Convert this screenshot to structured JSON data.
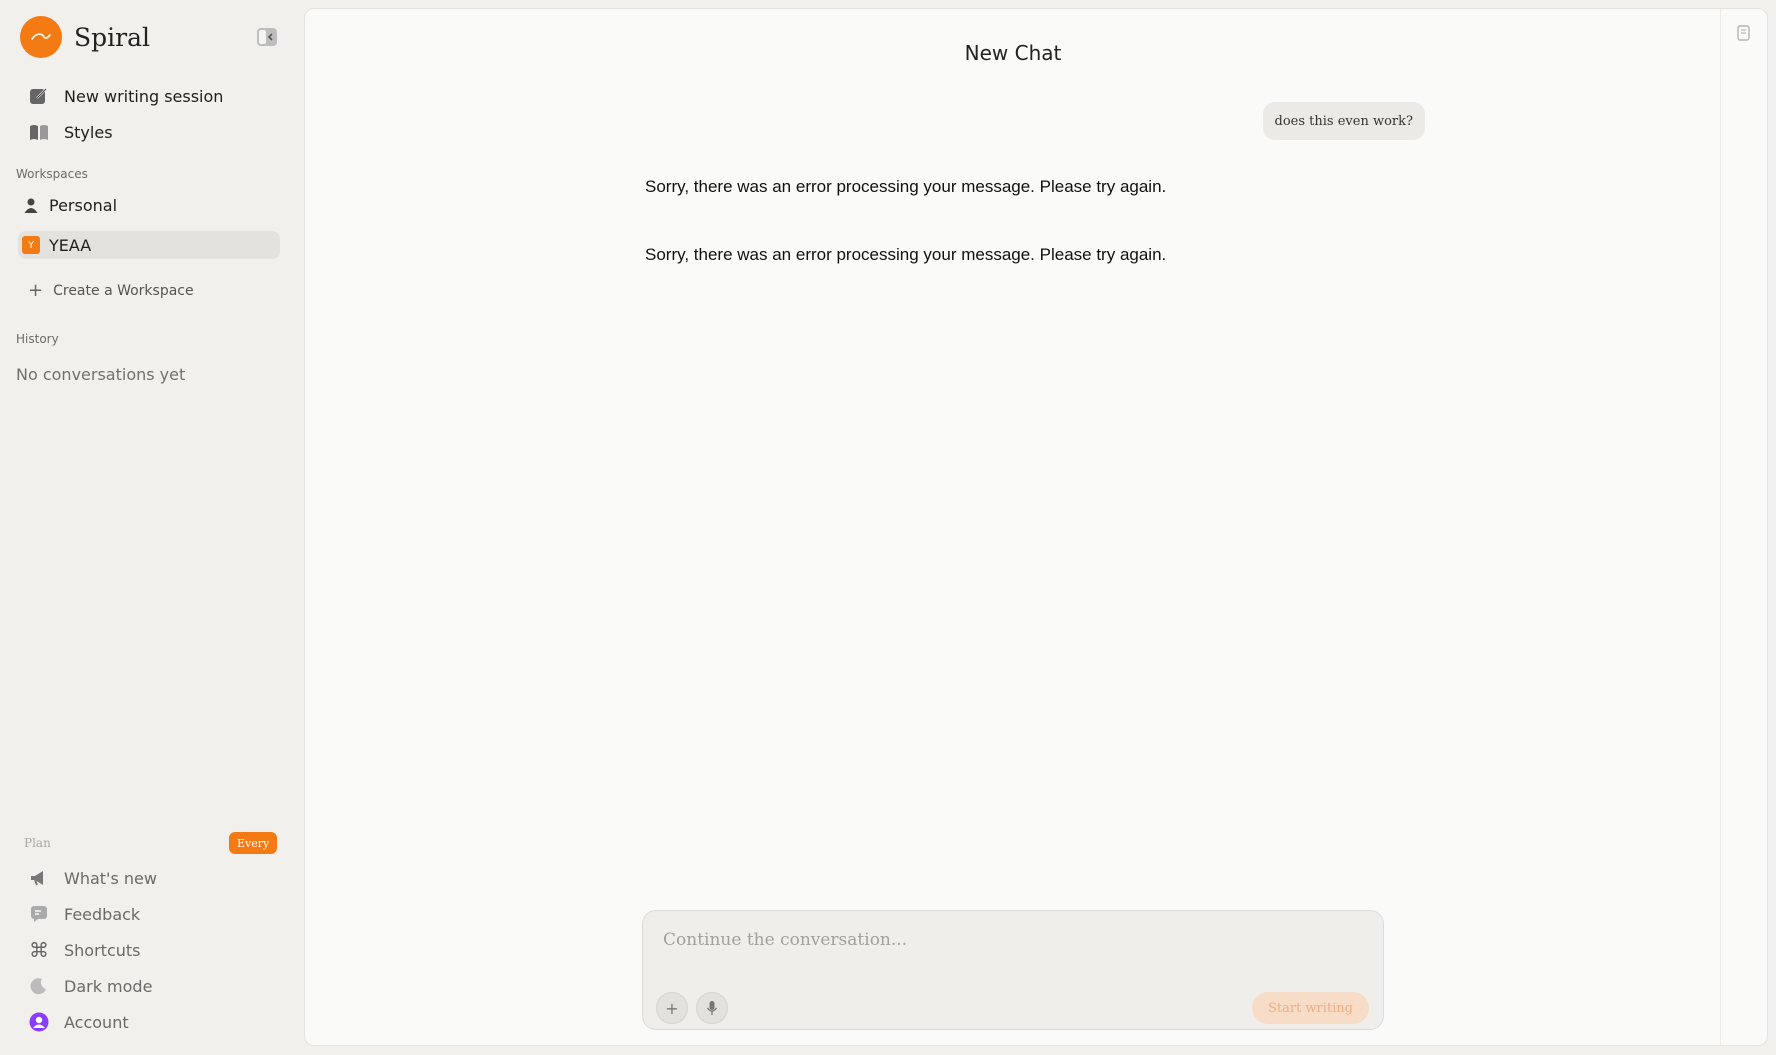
{
  "brand": {
    "name": "Spiral",
    "accent": "#f47a14"
  },
  "nav": [
    {
      "label": "New writing session",
      "icon": "new-writing-icon"
    },
    {
      "label": "Styles",
      "icon": "book-icon"
    }
  ],
  "workspaces": {
    "label": "Workspaces",
    "items": [
      {
        "label": "Personal",
        "icon": "person-icon",
        "active": false
      },
      {
        "label": "YEAA",
        "badge": "Y",
        "active": true
      }
    ],
    "create_label": "Create a Workspace"
  },
  "history": {
    "label": "History",
    "empty_text": "No conversations yet"
  },
  "plan": {
    "label": "Plan",
    "badge": "Every"
  },
  "bottom_nav": [
    {
      "label": "What's new",
      "icon": "megaphone-icon"
    },
    {
      "label": "Feedback",
      "icon": "feedback-icon"
    },
    {
      "label": "Shortcuts",
      "icon": "command-icon"
    },
    {
      "label": "Dark mode",
      "icon": "moon-icon"
    },
    {
      "label": "Account",
      "icon": "account-icon"
    }
  ],
  "chat": {
    "title": "New Chat",
    "messages": [
      {
        "role": "user",
        "text": "does this even work?"
      },
      {
        "role": "assistant",
        "text": "Sorry, there was an error processing your message. Please try again."
      },
      {
        "role": "assistant",
        "text": "Sorry, there was an error processing your message. Please try again."
      }
    ],
    "composer": {
      "placeholder": "Continue the conversation...",
      "value": "",
      "submit_label": "Start writing"
    }
  }
}
